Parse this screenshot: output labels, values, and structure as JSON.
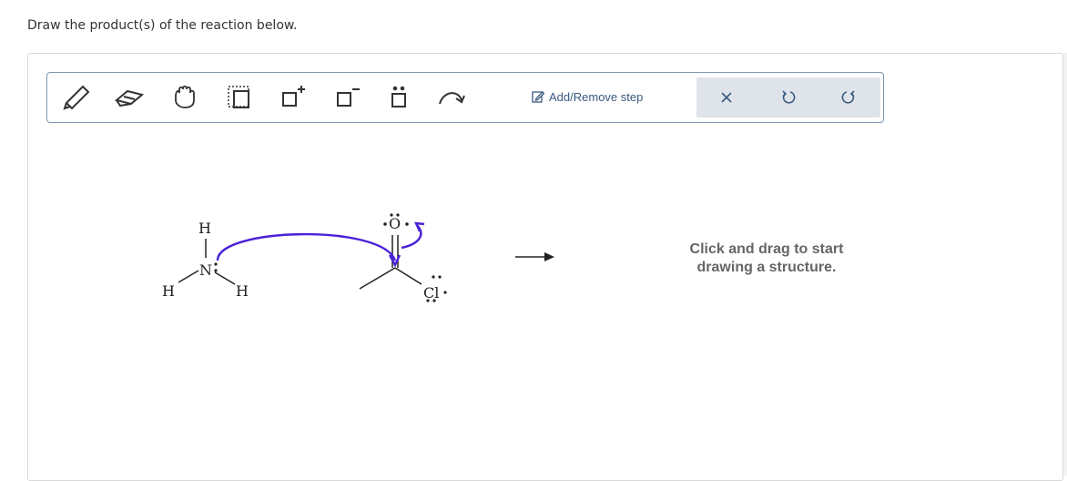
{
  "prompt": "Draw the product(s) of the reaction below.",
  "toolbar": {
    "tools": [
      {
        "name": "pencil-icon"
      },
      {
        "name": "eraser-icon"
      },
      {
        "name": "hand-icon"
      },
      {
        "name": "select-box-icon"
      },
      {
        "name": "positive-charge-icon"
      },
      {
        "name": "negative-charge-icon"
      },
      {
        "name": "lone-pair-icon"
      },
      {
        "name": "curved-arrow-icon"
      }
    ],
    "add_remove_step": "Add/Remove step",
    "actions": [
      {
        "name": "clear-icon"
      },
      {
        "name": "undo-icon"
      },
      {
        "name": "redo-icon"
      }
    ]
  },
  "reaction": {
    "nucleophile_atoms": [
      "H",
      "N",
      "H",
      "H"
    ],
    "electrophile_atoms": [
      "O",
      "Cl"
    ]
  },
  "hint": {
    "line1": "Click and drag to start",
    "line2": "drawing a structure."
  },
  "colors": {
    "arrow": "#4a22d8",
    "toolbar_border": "#7d97b4",
    "action_bg": "#dfe4ea"
  }
}
